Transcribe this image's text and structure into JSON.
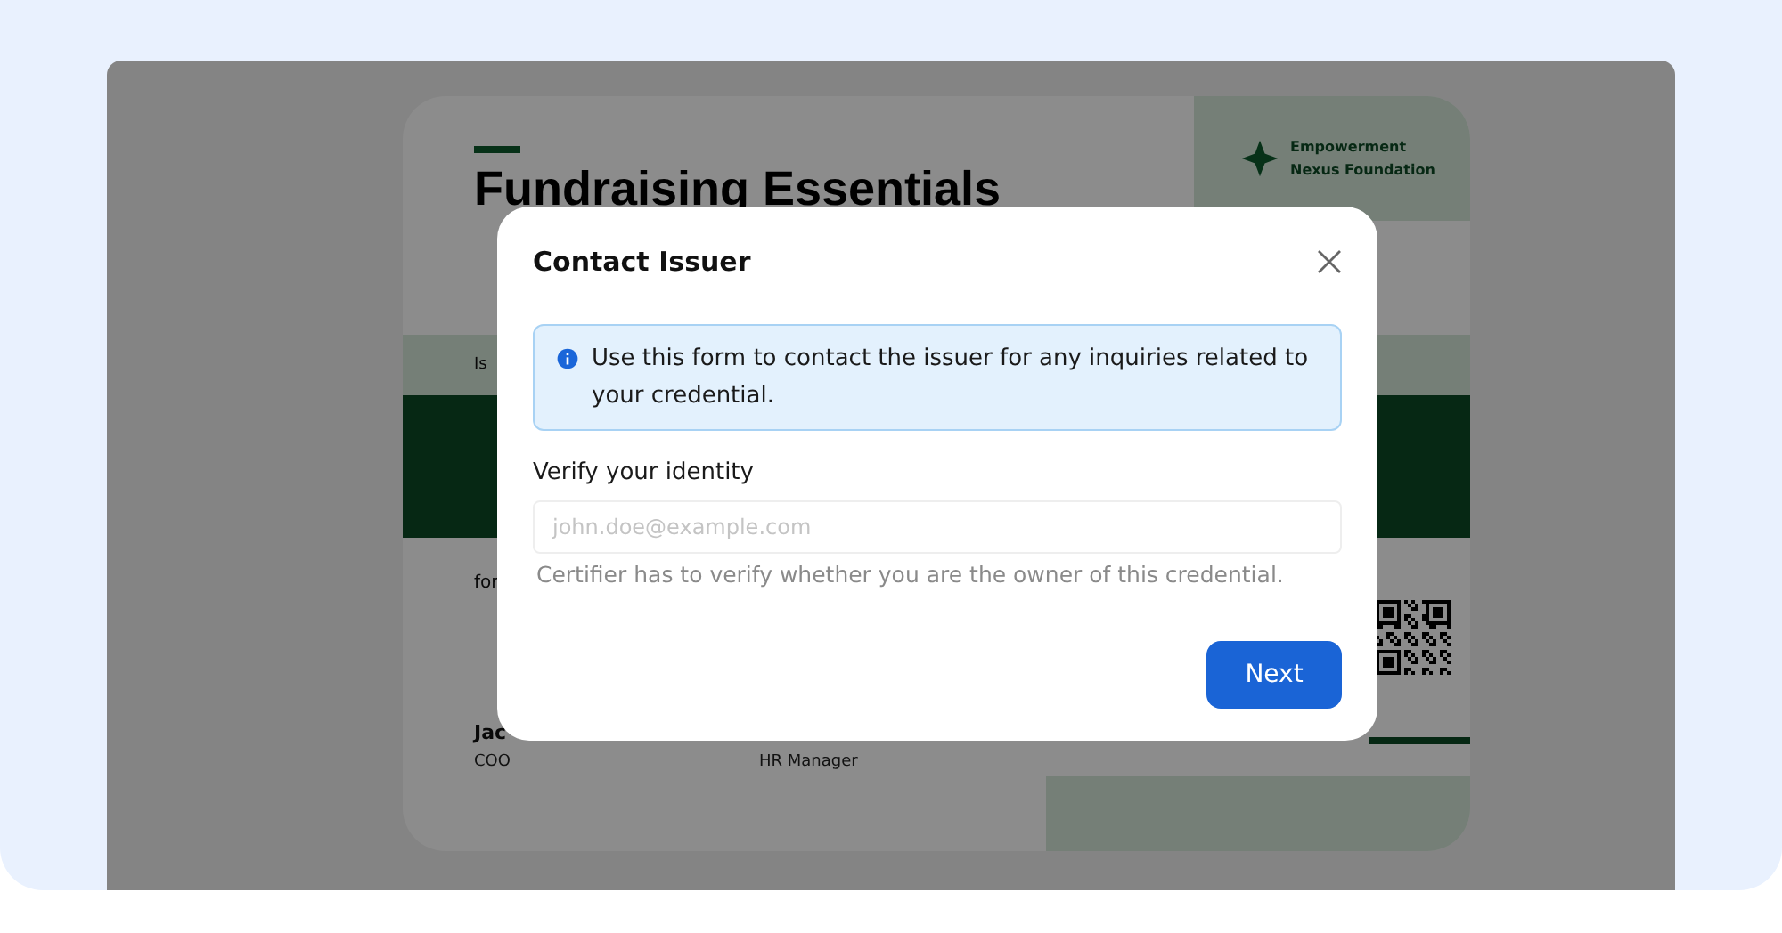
{
  "certificate": {
    "title_lines": [
      "Fundraising Essentials"
    ],
    "issuer_lines": [
      "Empowerment",
      "Nexus Foundation"
    ],
    "presented_text": "Is",
    "for_text": "for",
    "signers": [
      {
        "name": "Jac",
        "role": "COO"
      },
      {
        "role": "HR Manager"
      }
    ]
  },
  "modal": {
    "title": "Contact Issuer",
    "info": "Use this form to contact the issuer for any inquiries related to your credential.",
    "field_label": "Verify your identity",
    "placeholder": "john.doe@example.com",
    "helper": "Certifier has to verify whether you are the owner of this credential.",
    "button": "Next"
  }
}
